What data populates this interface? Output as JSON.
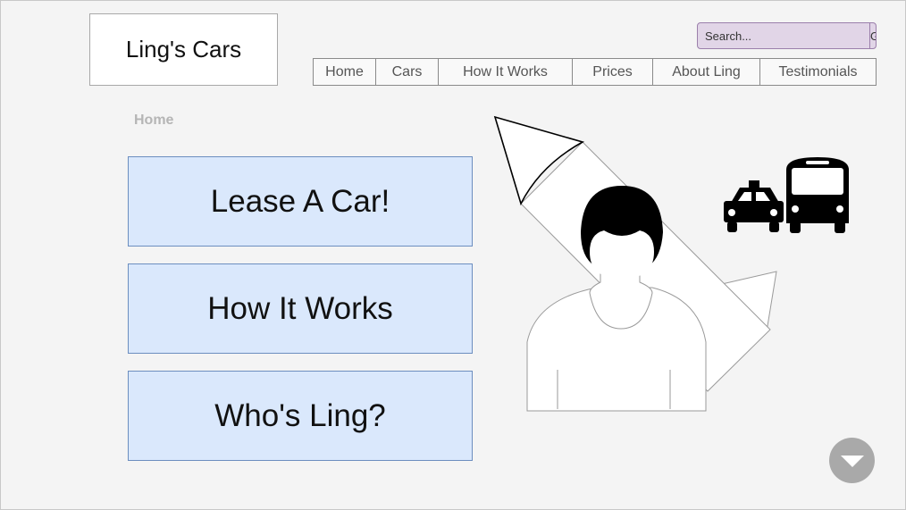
{
  "logo": {
    "text": "Ling's Cars"
  },
  "search": {
    "placeholder": "Search...",
    "go_label": "Go!"
  },
  "nav": {
    "items": [
      {
        "label": "Home"
      },
      {
        "label": "Cars"
      },
      {
        "label": "How It Works"
      },
      {
        "label": "Prices"
      },
      {
        "label": "About Ling"
      },
      {
        "label": "Testimonials"
      }
    ]
  },
  "breadcrumb": {
    "current": "Home"
  },
  "main": {
    "buttons": [
      {
        "label": "Lease A Car!"
      },
      {
        "label": "How It Works"
      },
      {
        "label": "Who's Ling?"
      }
    ]
  },
  "icons": {
    "hero": "rocket-with-person-illustration",
    "vehicles": [
      "taxi-icon",
      "bus-icon"
    ],
    "scroll": "chevron-down-icon"
  },
  "colors": {
    "background": "#f4f4f4",
    "button_fill": "#dae8fc",
    "button_border": "#6c8ebf",
    "search_fill": "#e1d5e7",
    "search_border": "#9b7fab",
    "scroll_button": "#a9a9a9"
  }
}
